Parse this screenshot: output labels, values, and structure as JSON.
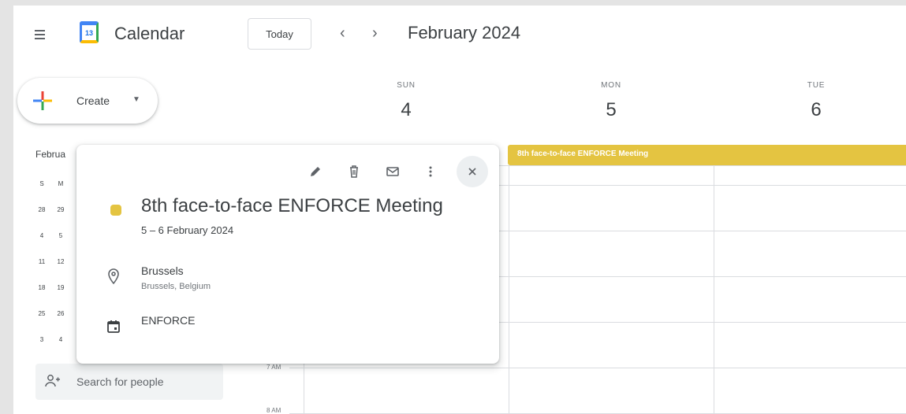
{
  "header": {
    "menu_icon": "hamburger-menu-icon",
    "logo_day": "13",
    "app_name": "Calendar",
    "today_label": "Today",
    "prev_icon": "chevron-left-icon",
    "next_icon": "chevron-right-icon",
    "month_title": "February 2024"
  },
  "sidebar": {
    "create_label": "Create",
    "create_icon": "plus-icon",
    "mini_calendar": {
      "month_label": "Februa",
      "weekday_headers": [
        "S",
        "M"
      ],
      "rows": [
        [
          "28",
          "29"
        ],
        [
          "4",
          "5"
        ],
        [
          "11",
          "12"
        ],
        [
          "18",
          "19"
        ],
        [
          "25",
          "26"
        ],
        [
          "3",
          "4"
        ]
      ]
    },
    "search_people_placeholder": "Search for people",
    "search_people_icon": "people-icon"
  },
  "grid": {
    "days": [
      {
        "name": "SUN",
        "number": "4"
      },
      {
        "name": "MON",
        "number": "5"
      },
      {
        "name": "TUE",
        "number": "6"
      }
    ],
    "time_labels": [
      "7 AM",
      "8 AM"
    ],
    "all_day_event": "8th face-to-face ENFORCE Meeting"
  },
  "popup": {
    "tools": [
      "edit-icon",
      "delete-icon",
      "email-icon",
      "more-options-icon",
      "close-icon"
    ],
    "event_color": "#e4c441",
    "title": "8th face-to-face ENFORCE Meeting",
    "date_range": "5 – 6 February 2024",
    "location_name": "Brussels",
    "location_detail": "Brussels, Belgium",
    "calendar_name": "ENFORCE"
  },
  "colors": {
    "accent": "#1a73e8",
    "event": "#e4c441",
    "border": "#dadce0"
  }
}
